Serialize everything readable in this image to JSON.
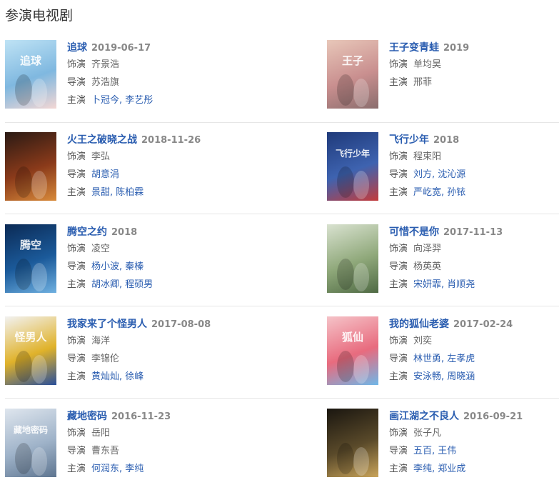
{
  "section_title": "参演电视剧",
  "labels": {
    "role": "饰演",
    "director": "导演",
    "cast": "主演"
  },
  "separator": ",",
  "items": [
    {
      "title": "追球",
      "date": "2019-06-17",
      "role": "齐景浩",
      "director": "苏浩旗",
      "director_link": false,
      "cast": [
        "卜冠今",
        "李艺彤"
      ],
      "poster_colors": [
        "#bfe3f5",
        "#7fb8e0",
        "#f4d7d4"
      ],
      "poster_text": "追球"
    },
    {
      "title": "王子变青蛙",
      "date": "2019",
      "role": "单均昊",
      "cast": [
        "邢菲"
      ],
      "cast_link": false,
      "poster_colors": [
        "#e8c7b9",
        "#c98f8f",
        "#8a6d6d"
      ],
      "poster_text": "王子"
    },
    {
      "title": "火王之破晓之战",
      "date": "2018-11-26",
      "role": "李弘",
      "director": "胡意涓",
      "director_link": true,
      "cast": [
        "景甜",
        "陈柏霖"
      ],
      "poster_colors": [
        "#2a1a14",
        "#8a3a1a",
        "#d88a3a"
      ],
      "poster_text": ""
    },
    {
      "title": "飞行少年",
      "date": "2018",
      "role": "程束阳",
      "director": "刘方, 沈沁源",
      "director_link": true,
      "cast": [
        "严屹宽",
        "孙铱"
      ],
      "poster_colors": [
        "#1f3a7a",
        "#3e63b0",
        "#c43b3b"
      ],
      "poster_text": "飞行少年"
    },
    {
      "title": "腾空之约",
      "date": "2018",
      "role": "凌空",
      "director": "杨小波, 秦榛",
      "director_link": true,
      "cast": [
        "胡冰卿",
        "程硕男"
      ],
      "poster_colors": [
        "#0b2a55",
        "#1b5a9a",
        "#6fb0e0"
      ],
      "poster_text": "腾空"
    },
    {
      "title": "可惜不是你",
      "date": "2017-11-13",
      "role": "向泽羿",
      "director": "杨英英",
      "director_link": false,
      "cast": [
        "宋妍霏",
        "肖顺尧"
      ],
      "poster_colors": [
        "#d9e2d0",
        "#8fa87a",
        "#4f6a44"
      ],
      "poster_text": ""
    },
    {
      "title": "我家来了个怪男人",
      "date": "2017-08-08",
      "role": "海洋",
      "director": "李锦伦",
      "director_link": false,
      "cast": [
        "黄灿灿",
        "徐峰"
      ],
      "poster_colors": [
        "#f2f2f2",
        "#e0b22a",
        "#2a4f9a"
      ],
      "poster_text": "怪男人"
    },
    {
      "title": "我的狐仙老婆",
      "date": "2017-02-24",
      "role": "刘奕",
      "director": "林世勇, 左孝虎",
      "director_link": true,
      "cast": [
        "安泳畅",
        "周晓涵"
      ],
      "poster_colors": [
        "#f5c3c8",
        "#e86b7e",
        "#6fb7e8"
      ],
      "poster_text": "狐仙"
    },
    {
      "title": "藏地密码",
      "date": "2016-11-23",
      "role": "岳阳",
      "director": "曹东吾",
      "director_link": false,
      "cast": [
        "何润东",
        "李纯"
      ],
      "poster_colors": [
        "#dfe6ee",
        "#9fb3c9",
        "#5e7590"
      ],
      "poster_text": "藏地密码"
    },
    {
      "title": "画江湖之不良人",
      "date": "2016-09-21",
      "role": "张子凡",
      "director": "五百, 王伟",
      "director_link": true,
      "cast": [
        "李纯",
        "郑业成"
      ],
      "poster_colors": [
        "#1a1610",
        "#5a4a2a",
        "#c9a45a"
      ],
      "poster_text": ""
    }
  ]
}
